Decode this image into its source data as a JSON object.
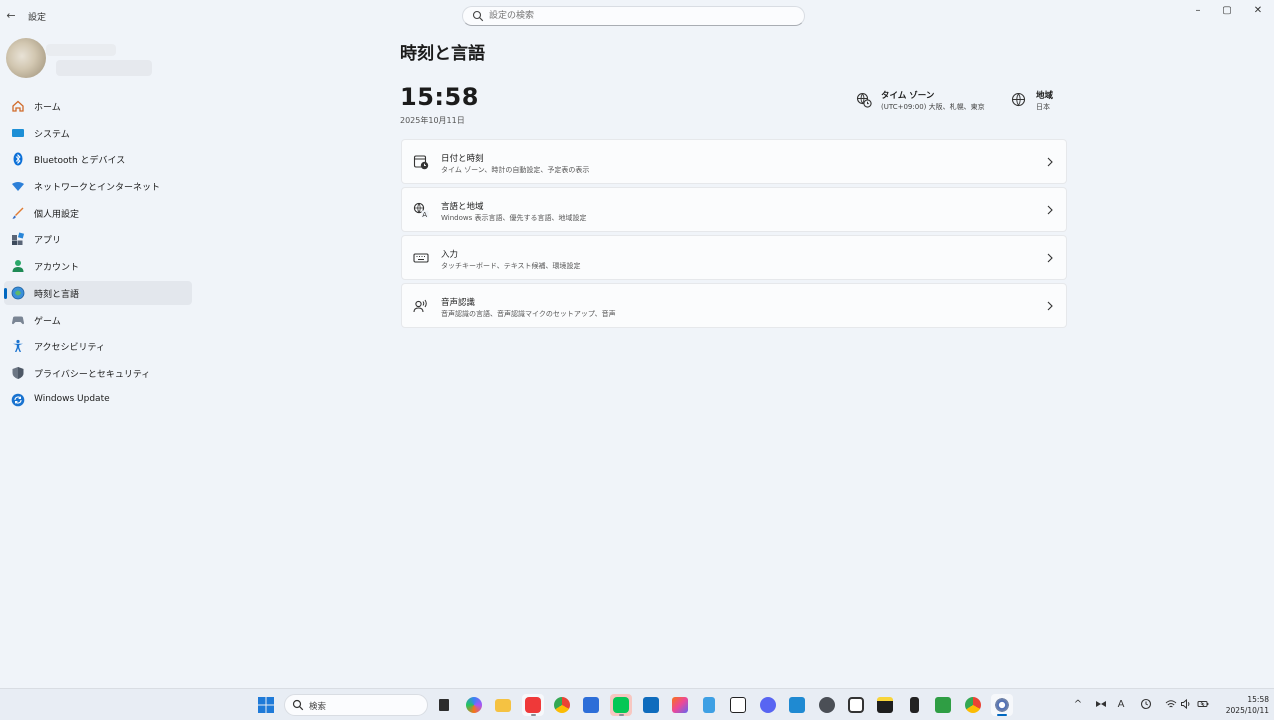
{
  "window": {
    "title": "設定",
    "search_placeholder": "設定の検索",
    "controls": {
      "minimize": "–",
      "maximize": "▢",
      "close": "✕"
    },
    "back": "←"
  },
  "sidebar": {
    "items": [
      {
        "label": "ホーム",
        "icon": "home-icon",
        "active": false
      },
      {
        "label": "システム",
        "icon": "system-icon",
        "active": false
      },
      {
        "label": "Bluetooth とデバイス",
        "icon": "bluetooth-icon",
        "active": false
      },
      {
        "label": "ネットワークとインターネット",
        "icon": "network-icon",
        "active": false
      },
      {
        "label": "個人用設定",
        "icon": "personalization-icon",
        "active": false
      },
      {
        "label": "アプリ",
        "icon": "apps-icon",
        "active": false
      },
      {
        "label": "アカウント",
        "icon": "account-icon",
        "active": false
      },
      {
        "label": "時刻と言語",
        "icon": "time-language-icon",
        "active": true
      },
      {
        "label": "ゲーム",
        "icon": "gaming-icon",
        "active": false
      },
      {
        "label": "アクセシビリティ",
        "icon": "accessibility-icon",
        "active": false
      },
      {
        "label": "プライバシーとセキュリティ",
        "icon": "privacy-icon",
        "active": false
      },
      {
        "label": "Windows Update",
        "icon": "windows-update-icon",
        "active": false
      }
    ]
  },
  "main": {
    "title": "時刻と言語",
    "time": "15:58",
    "date": "2025年10月11日",
    "timezone": {
      "title": "タイム ゾーン",
      "value": "(UTC+09:00) 大阪、札幌、東京",
      "icon": "timezone-icon"
    },
    "region": {
      "title": "地域",
      "value": "日本",
      "icon": "globe-icon"
    },
    "cards": [
      {
        "title": "日付と時刻",
        "subtitle": "タイム ゾーン、時計の自動設定、予定表の表示",
        "icon": "calendar-clock-icon"
      },
      {
        "title": "言語と地域",
        "subtitle": "Windows 表示言語、優先する言語、地域設定",
        "icon": "language-icon"
      },
      {
        "title": "入力",
        "subtitle": "タッチキーボード、テキスト候補、環境設定",
        "icon": "keyboard-icon"
      },
      {
        "title": "音声認識",
        "subtitle": "音声認識の言語、音声認識マイクのセットアップ、音声",
        "icon": "speech-icon"
      }
    ]
  },
  "taskbar": {
    "search_label": "検索",
    "apps": [
      "task-view",
      "copilot",
      "file-explorer",
      "vivaldi",
      "chrome",
      "store",
      "line",
      "outlook",
      "photos",
      "notepad",
      "notion",
      "discord",
      "vscode",
      "unity",
      "clock-app",
      "sticky-notes",
      "music",
      "minecraft",
      "chrome-profile",
      "settings"
    ],
    "tray": {
      "chevron": "^",
      "ime": "A",
      "time": "15:58",
      "date": "2025/10/11"
    }
  },
  "colors": {
    "accent": "#0067c0",
    "background": "#f0f4f9",
    "card": "#fbfcfd"
  }
}
